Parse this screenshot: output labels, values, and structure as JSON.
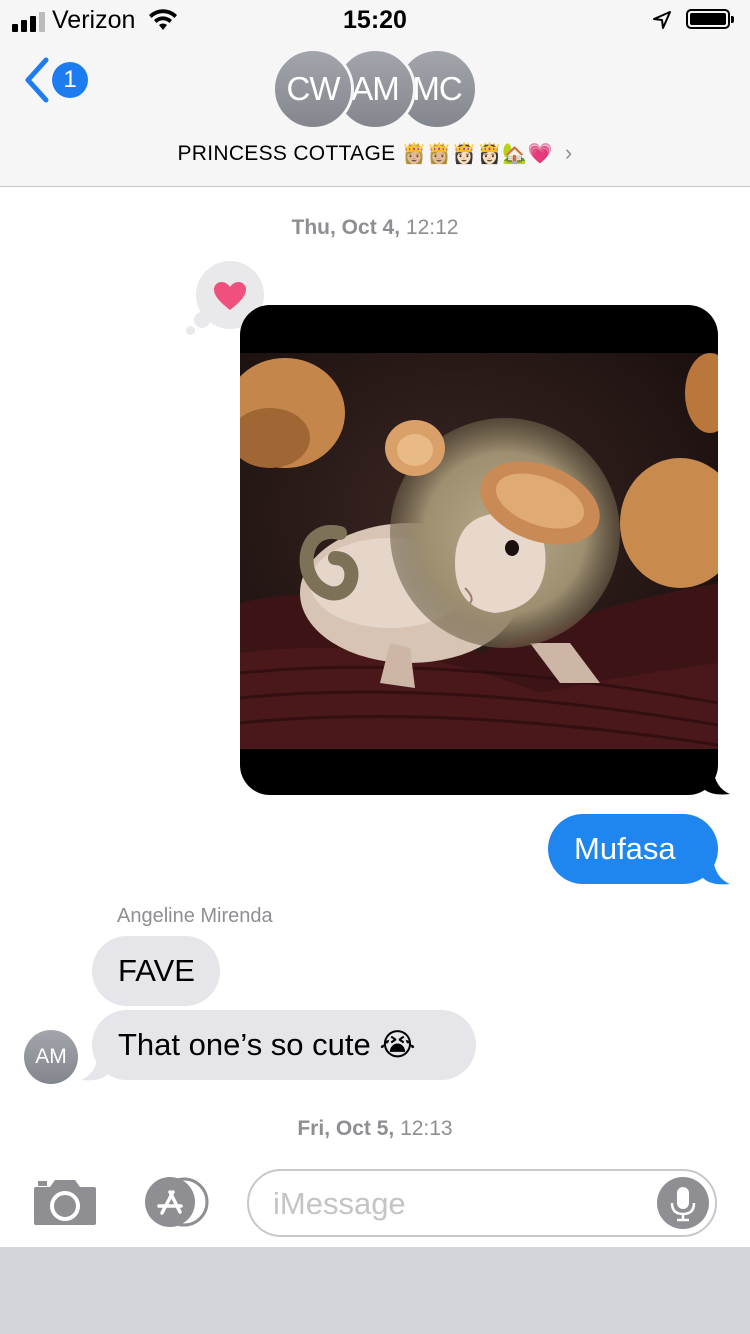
{
  "status_bar": {
    "carrier": "Verizon",
    "time": "15:20"
  },
  "header": {
    "back_badge": "1",
    "avatars": [
      "CW",
      "AM",
      "MC"
    ],
    "group_name": "PRINCESS COTTAGE",
    "group_emojis": "👸🏼👸🏼👸🏻👸🏻🏡💗",
    "chevron": "›"
  },
  "conversation": {
    "timestamp1": {
      "day": "Thu, Oct 4,",
      "time": "12:12"
    },
    "tapback": "heart",
    "photo_description_icon": "photo-attachment",
    "outgoing_message": "Mufasa",
    "sender_name": "Angeline Mirenda",
    "incoming_messages": [
      "FAVE",
      "That one’s so cute"
    ],
    "incoming_emoji": "😭",
    "sender_avatar": "AM",
    "timestamp2": {
      "day": "Fri, Oct 5,",
      "time": "12:13"
    }
  },
  "input": {
    "placeholder": "iMessage"
  },
  "colors": {
    "accent": "#1f86ef",
    "incoming_bubble": "#e5e5ea",
    "tapback_heart": "#f0507e"
  }
}
